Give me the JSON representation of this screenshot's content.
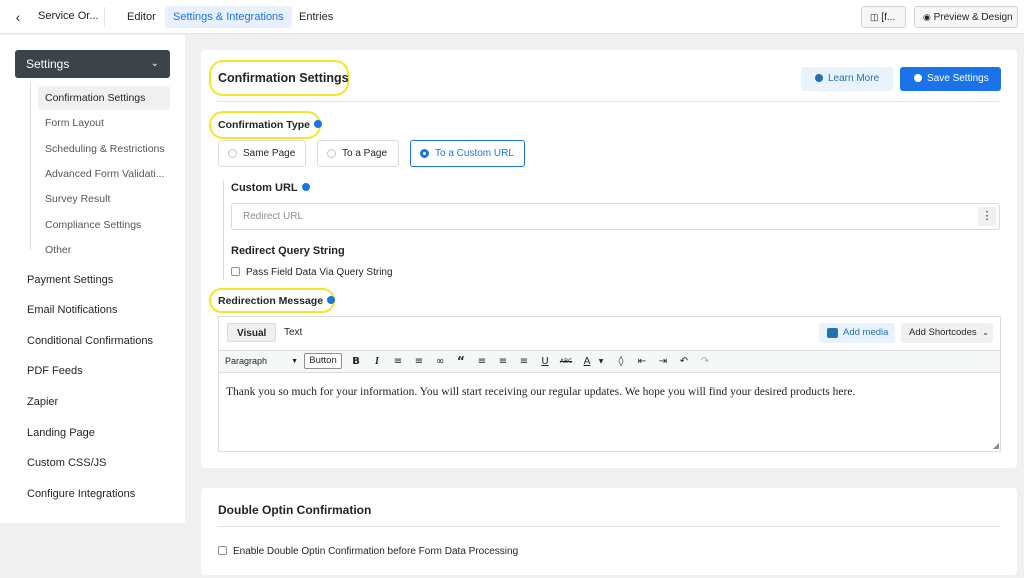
{
  "topbar": {
    "back_icon": "chevron-left-icon",
    "form_name": "Service Or...",
    "tabs": [
      "Editor",
      "Settings & Integrations",
      "Entries"
    ],
    "shortcode_label": "[f...",
    "preview_label": "Preview & Design"
  },
  "sidebar": {
    "settings_label": "Settings",
    "sub_items": [
      "Confirmation Settings",
      "Form Layout",
      "Scheduling & Restrictions",
      "Advanced Form Validati...",
      "Survey Result",
      "Compliance Settings",
      "Other"
    ],
    "main_items": [
      "Payment Settings",
      "Email Notifications",
      "Conditional Confirmations",
      "PDF Feeds",
      "Zapier",
      "Landing Page",
      "Custom CSS/JS",
      "Configure Integrations"
    ]
  },
  "confirmation": {
    "title": "Confirmation Settings",
    "learn_more": "Learn More",
    "save_settings": "Save Settings",
    "type_label": "Confirmation Type",
    "options": [
      "Same Page",
      "To a Page",
      "To a Custom URL"
    ],
    "selected_option": "To a Custom URL",
    "custom_url_label": "Custom URL",
    "redirect_placeholder": "Redirect URL",
    "query_string_label": "Redirect Query String",
    "pass_field_label": "Pass Field Data Via Query String",
    "redirection_label": "Redirection Message",
    "editor": {
      "tab_visual": "Visual",
      "tab_text": "Text",
      "add_media": "Add media",
      "add_shortcodes": "Add Shortcodes",
      "paragraph": "Paragraph",
      "button_label": "Button",
      "body": "Thank you so much for your information. You will start receiving our regular updates. We hope you will find your desired products here."
    }
  },
  "double_optin": {
    "title": "Double Optin Confirmation",
    "checkbox_label": "Enable Double Optin Confirmation before Form Data Processing"
  },
  "colors": {
    "accent": "#1a73e8",
    "highlight": "#f3e52a",
    "sidebar_head": "#3c434a"
  }
}
